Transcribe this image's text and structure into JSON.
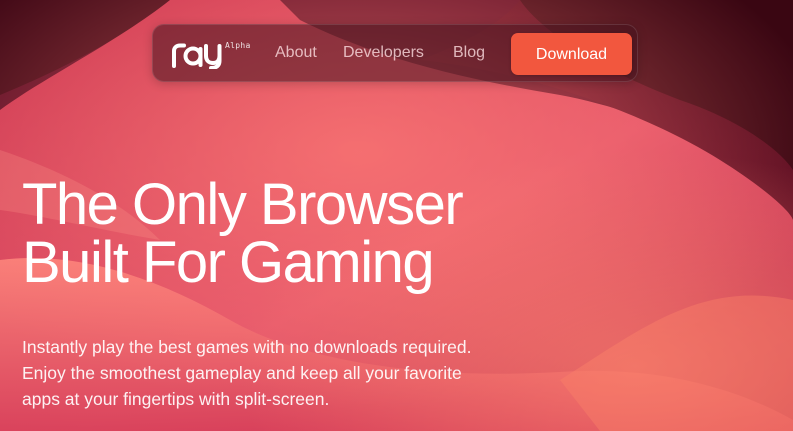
{
  "brand": {
    "logo_text": "ray",
    "badge": "Alpha"
  },
  "nav": {
    "links": [
      {
        "label": "About"
      },
      {
        "label": "Developers"
      },
      {
        "label": "Blog"
      }
    ],
    "cta_label": "Download"
  },
  "hero": {
    "title_lines": [
      "The Only Browser",
      "Built For Gaming"
    ],
    "subtitle_lines": [
      "Instantly play the best games with no downloads required.",
      "Enjoy the smoothest gameplay and keep all your favorite",
      "apps at your fingertips with split-screen."
    ]
  },
  "colors": {
    "accent": "#f2573e",
    "background_dark": "#4a0a1e",
    "background_light": "#e8505f"
  }
}
